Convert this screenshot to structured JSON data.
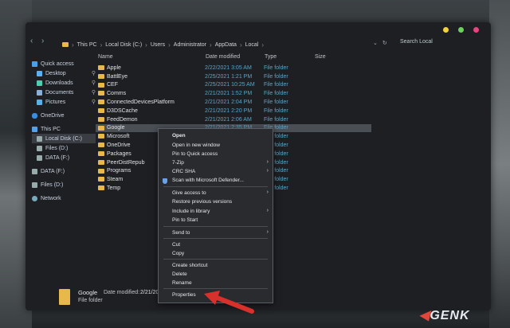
{
  "nav": {
    "back": "‹",
    "forward": "›",
    "up": "∧"
  },
  "breadcrumb": [
    "This PC",
    "Local Disk (C:)",
    "Users",
    "Administrator",
    "AppData",
    "Local"
  ],
  "search": {
    "placeholder": "Search Local"
  },
  "window_dots": {
    "colors": [
      "#f5d13a",
      "#6ad35a",
      "#e8457e"
    ]
  },
  "columns": {
    "name": "Name",
    "date": "Date modified",
    "type": "Type",
    "size": "Size"
  },
  "sidebar": {
    "items": [
      {
        "label": "Quick access",
        "icon": "star-icon",
        "color": "#4aa0e8",
        "pinned": false
      },
      {
        "label": "Desktop",
        "icon": "desktop-icon",
        "color": "#5ab0f0",
        "pinned": true
      },
      {
        "label": "Downloads",
        "icon": "download-icon",
        "color": "#4ad0b0",
        "pinned": true
      },
      {
        "label": "Documents",
        "icon": "document-icon",
        "color": "#8ab0d8",
        "pinned": true
      },
      {
        "label": "Pictures",
        "icon": "picture-icon",
        "color": "#5ab0e0",
        "pinned": true
      },
      {
        "label": "OneDrive",
        "icon": "cloud-icon",
        "color": "#3a8ee0",
        "pinned": false
      },
      {
        "label": "This PC",
        "icon": "computer-icon",
        "color": "#5aa0e0",
        "pinned": false
      },
      {
        "label": "Local Disk (C:)",
        "icon": "drive-icon",
        "color": "#9aa",
        "pinned": false,
        "selected": true
      },
      {
        "label": "Files (D:)",
        "icon": "drive-icon",
        "color": "#9aa",
        "pinned": false
      },
      {
        "label": "DATA (F:)",
        "icon": "drive-icon",
        "color": "#9aa",
        "pinned": false
      },
      {
        "label": "DATA (F:)",
        "icon": "drive-icon",
        "color": "#9aa",
        "pinned": false
      },
      {
        "label": "Files (D:)",
        "icon": "drive-icon",
        "color": "#9aa",
        "pinned": false
      },
      {
        "label": "Network",
        "icon": "network-icon",
        "color": "#7ab",
        "pinned": false
      }
    ]
  },
  "files": [
    {
      "name": "Apple",
      "date": "2/22/2021 3:05 AM",
      "type": "File folder"
    },
    {
      "name": "BattlEye",
      "date": "2/25/2021 1:21 PM",
      "type": "File folder"
    },
    {
      "name": "CEF",
      "date": "2/25/2021 10:25 AM",
      "type": "File folder"
    },
    {
      "name": "Comms",
      "date": "2/21/2021 1:52 PM",
      "type": "File folder"
    },
    {
      "name": "ConnectedDevicesPlatform",
      "date": "2/21/2021 2:04 PM",
      "type": "File folder"
    },
    {
      "name": "D3DSCache",
      "date": "2/21/2021 2:20 PM",
      "type": "File folder"
    },
    {
      "name": "FeedDemon",
      "date": "2/21/2021 2:06 AM",
      "type": "File folder"
    },
    {
      "name": "Google",
      "date": "2/21/2021 2:35 PM",
      "type": "File folder",
      "selected": true
    },
    {
      "name": "Microsoft",
      "date": "",
      "type": "File folder"
    },
    {
      "name": "OneDrive",
      "date": "",
      "type": "File folder"
    },
    {
      "name": "Packages",
      "date": "",
      "type": "File folder"
    },
    {
      "name": "PeerDistRepub",
      "date": "",
      "type": "File folder"
    },
    {
      "name": "Programs",
      "date": "",
      "type": "File folder"
    },
    {
      "name": "Steam",
      "date": "",
      "type": "File folder"
    },
    {
      "name": "Temp",
      "date": "",
      "type": "File folder"
    }
  ],
  "context_menu": {
    "items": [
      {
        "label": "Open",
        "bold": true
      },
      {
        "label": "Open in new window"
      },
      {
        "label": "Pin to Quick access"
      },
      {
        "label": "7-Zip",
        "submenu": true
      },
      {
        "label": "CRC SHA",
        "submenu": true
      },
      {
        "label": "Scan with Microsoft Defender...",
        "icon": "defender-icon"
      },
      {
        "label": "Give access to",
        "submenu": true
      },
      {
        "label": "Restore previous versions"
      },
      {
        "label": "Include in library",
        "submenu": true
      },
      {
        "label": "Pin to Start"
      },
      {
        "label": "Send to",
        "submenu": true
      },
      {
        "label": "Cut"
      },
      {
        "label": "Copy"
      },
      {
        "label": "Create shortcut"
      },
      {
        "label": "Delete"
      },
      {
        "label": "Rename"
      },
      {
        "label": "Properties"
      }
    ]
  },
  "details": {
    "name": "Google",
    "date_label": "Date modified:",
    "date": "2/21/2021 2:35 PM",
    "type": "File folder"
  },
  "watermark": {
    "brand": "GENK"
  },
  "annotation": {
    "arrow_color": "#d8302a"
  }
}
